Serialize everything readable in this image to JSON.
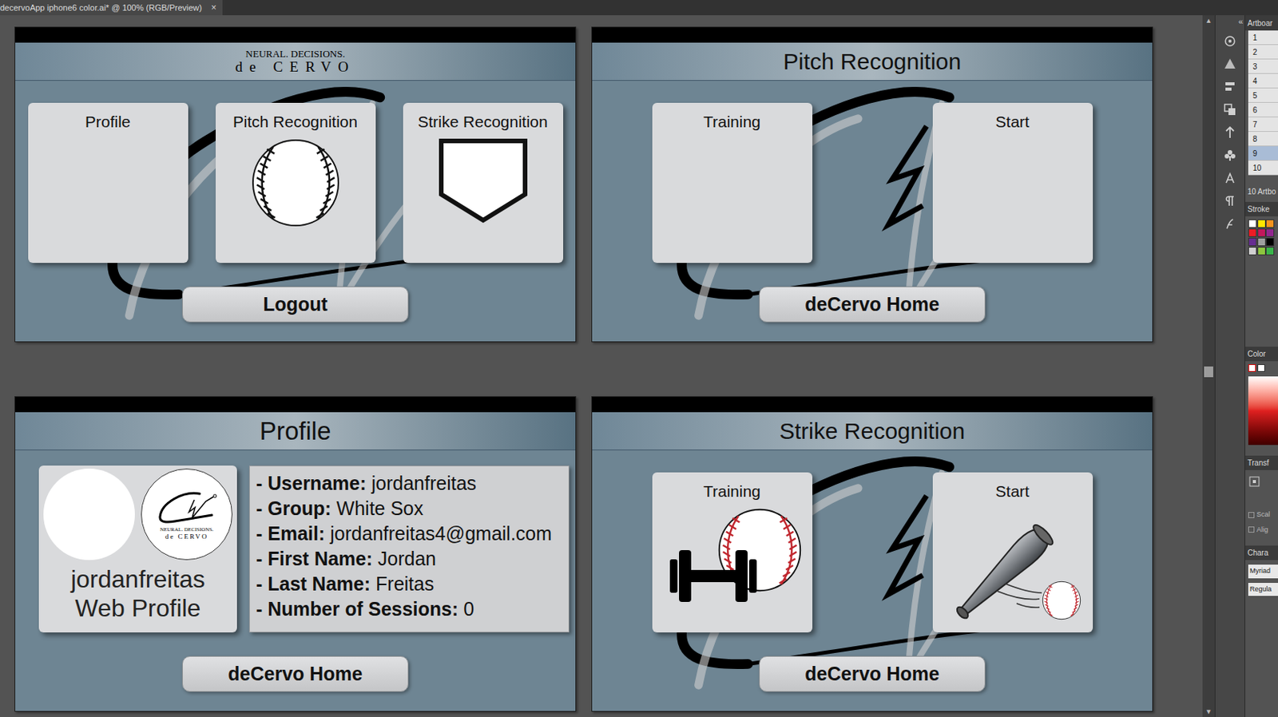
{
  "document_tab": {
    "title": "decervoApp iphone6 color.ai* @ 100% (RGB/Preview)",
    "close": "×"
  },
  "artboards": [
    {
      "kind": "home",
      "logo": {
        "line1": "NEURAL. DECISIONS.",
        "line2": "de CERVO"
      },
      "cards": [
        {
          "label": "Profile",
          "kind": "blank"
        },
        {
          "label": "Pitch Recognition",
          "kind": "baseball"
        },
        {
          "label": "Strike Recognition",
          "kind": "plate"
        }
      ],
      "button": "Logout"
    },
    {
      "kind": "menu",
      "title": "Pitch Recognition",
      "cards": [
        {
          "label": "Training",
          "kind": "blank"
        },
        {
          "label": "Start",
          "kind": "blank"
        }
      ],
      "button": "deCervo Home"
    },
    {
      "kind": "profile",
      "title": "Profile",
      "profile_card": {
        "logo": {
          "line1": "NEURAL. DECISIONS.",
          "line2": "de CERVO"
        },
        "name": "jordanfreitas",
        "caption": "Web Profile"
      },
      "fields": [
        {
          "label": "- Username:",
          "value": "jordanfreitas"
        },
        {
          "label": "- Group:",
          "value": "White Sox"
        },
        {
          "label": "- Email:",
          "value": "jordanfreitas4@gmail.com"
        },
        {
          "label": "- First Name:",
          "value": "Jordan"
        },
        {
          "label": "- Last Name:",
          "value": "Freitas"
        },
        {
          "label": "- Number of Sessions:",
          "value": "0"
        }
      ],
      "button": "deCervo Home"
    },
    {
      "kind": "menu",
      "title": "Strike Recognition",
      "cards": [
        {
          "label": "Training",
          "kind": "training"
        },
        {
          "label": "Start",
          "kind": "bat"
        }
      ],
      "button": "deCervo Home"
    }
  ],
  "scrollbar": {
    "up": "▲",
    "down": "▼",
    "level": 0.5
  },
  "panels": {
    "collapse": "«",
    "artboards_title": "Artboar",
    "artboard_rows": [
      {
        "label": "1",
        "selected": false
      },
      {
        "label": "2",
        "selected": false
      },
      {
        "label": "3",
        "selected": false
      },
      {
        "label": "4",
        "selected": false
      },
      {
        "label": "5",
        "selected": false
      },
      {
        "label": "6",
        "selected": false
      },
      {
        "label": "7",
        "selected": false
      },
      {
        "label": "8",
        "selected": false
      },
      {
        "label": "9",
        "selected": true
      },
      {
        "label": "10",
        "selected": false
      }
    ],
    "artboard_count": "10 Artbo",
    "stroke_title": "Stroke",
    "color_title": "Color",
    "transform_title": "Transf",
    "transform_options": [
      "Scal",
      "Alig"
    ],
    "character_title": "Chara",
    "font_family": "Myriad",
    "font_style": "Regula"
  }
}
